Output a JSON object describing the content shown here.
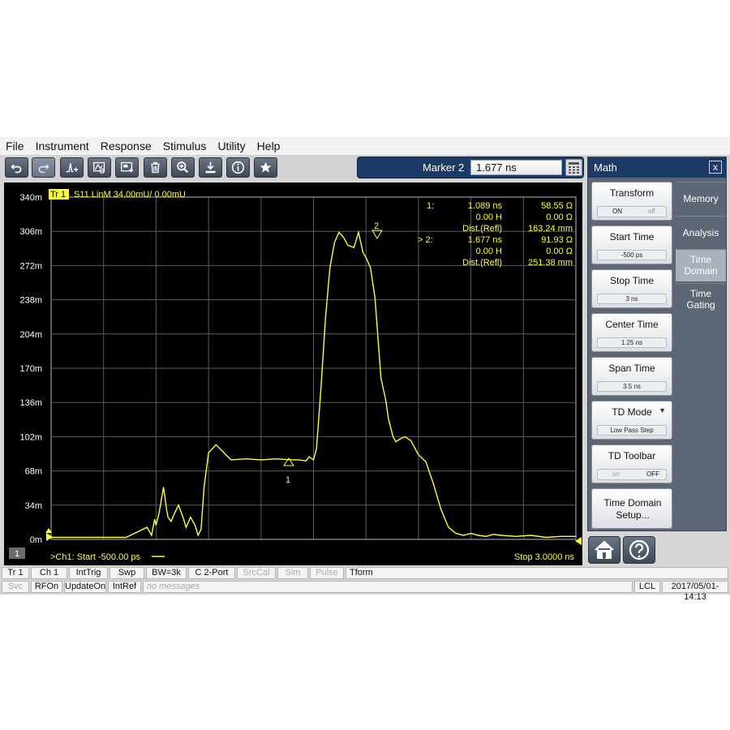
{
  "menu": [
    "File",
    "Instrument",
    "Response",
    "Stimulus",
    "Utility",
    "Help"
  ],
  "toolbar": {
    "buttons": [
      "undo-icon",
      "redo-icon",
      "marker-add-icon",
      "marker-search-icon",
      "screenshot-icon",
      "delete-icon",
      "zoom-icon",
      "save-icon",
      "info-icon",
      "star-icon"
    ],
    "marker_label": "Marker 2",
    "marker_value": "1.677 ns"
  },
  "trace": {
    "tag": "Tr 1",
    "header": "S11 LinM 34.00mU/ 0.00mU",
    "color": "#ffff33",
    "y_ticks": [
      "340m",
      "306m",
      "272m",
      "238m",
      "204m",
      "170m",
      "136m",
      "102m",
      "68m",
      "34m",
      "0m"
    ],
    "channel_num": "1",
    "start_text": ">Ch1:  Start  -500.00 ps",
    "stop_text": "Stop  3.0000 ns"
  },
  "markers": {
    "m1": {
      "tag": "1:",
      "time": "1.089  ns",
      "value": "58.55 Ω",
      "h": "0.00 H",
      "h_value": "0.00 Ω",
      "dist_label": "Dist.(Refl)",
      "dist": "163.24 mm",
      "label": "1"
    },
    "m2": {
      "tag": "> 2:",
      "time": "1.677  ns",
      "value": "91.93 Ω",
      "h": "0.00 H",
      "h_value": "0.00 Ω",
      "dist_label": "Dist.(Refl)",
      "dist": "251.38 mm",
      "label": "2"
    }
  },
  "chart_data": {
    "type": "line",
    "x_unit": "ns",
    "y_unit": "U",
    "xlim": [
      -0.5,
      3.0
    ],
    "ylim": [
      0,
      0.34
    ],
    "grid": true,
    "series": [
      {
        "name": "S11 LinM",
        "x": [
          -0.5,
          0.0,
          0.14,
          0.17,
          0.19,
          0.2,
          0.22,
          0.25,
          0.27,
          0.28,
          0.3,
          0.33,
          0.35,
          0.38,
          0.4,
          0.43,
          0.46,
          0.48,
          0.5,
          0.52,
          0.55,
          0.6,
          0.7,
          0.8,
          0.9,
          1.0,
          1.1,
          1.15,
          1.2,
          1.22,
          1.25,
          1.27,
          1.3,
          1.33,
          1.36,
          1.39,
          1.42,
          1.45,
          1.48,
          1.52,
          1.55,
          1.58,
          1.6,
          1.63,
          1.66,
          1.7,
          1.73,
          1.75,
          1.78,
          1.8,
          1.83,
          1.86,
          1.9,
          1.95,
          2.0,
          2.05,
          2.1,
          2.15,
          2.2,
          2.25,
          2.3,
          2.35,
          2.4,
          2.45,
          2.5,
          2.6,
          2.7,
          2.8,
          2.9,
          3.0
        ],
        "y": [
          0.002,
          0.002,
          0.012,
          0.004,
          0.02,
          0.014,
          0.026,
          0.052,
          0.03,
          0.022,
          0.018,
          0.028,
          0.034,
          0.022,
          0.012,
          0.022,
          0.014,
          0.004,
          0.01,
          0.052,
          0.086,
          0.094,
          0.079,
          0.08,
          0.079,
          0.08,
          0.079,
          0.079,
          0.078,
          0.082,
          0.079,
          0.09,
          0.15,
          0.22,
          0.27,
          0.295,
          0.305,
          0.3,
          0.292,
          0.29,
          0.305,
          0.285,
          0.28,
          0.27,
          0.24,
          0.16,
          0.14,
          0.12,
          0.102,
          0.097,
          0.1,
          0.102,
          0.098,
          0.084,
          0.077,
          0.055,
          0.03,
          0.012,
          0.006,
          0.004,
          0.006,
          0.004,
          0.003,
          0.005,
          0.004,
          0.003,
          0.004,
          0.002,
          0.003,
          0.003
        ]
      }
    ]
  },
  "panel": {
    "title": "Math",
    "close": "x",
    "softkeys": [
      {
        "label": "Transform",
        "on": "ON",
        "off": "off"
      },
      {
        "label": "Start Time",
        "value": "-500 ps"
      },
      {
        "label": "Stop Time",
        "value": "3 ns"
      },
      {
        "label": "Center Time",
        "value": "1.25 ns"
      },
      {
        "label": "Span Time",
        "value": "3.5 ns"
      },
      {
        "label": "TD Mode",
        "value": "Low Pass Step"
      },
      {
        "label": "TD Toolbar",
        "on": "on",
        "off": "OFF"
      },
      {
        "label": "Time Domain Setup..."
      }
    ],
    "tabs": [
      "Memory",
      "Analysis",
      "Time Domain",
      "Time Gating"
    ]
  },
  "status1": [
    "Tr 1",
    "Ch 1",
    "IntTrig",
    "Swp",
    "BW=3k",
    "C  2-Port",
    "SrcCal",
    "Sim",
    "Pulse",
    "Tform"
  ],
  "status2": [
    "Svc",
    "RFOn",
    "UpdateOn",
    "IntRef",
    "no messages",
    "LCL",
    "2017/05/01-14:13"
  ]
}
